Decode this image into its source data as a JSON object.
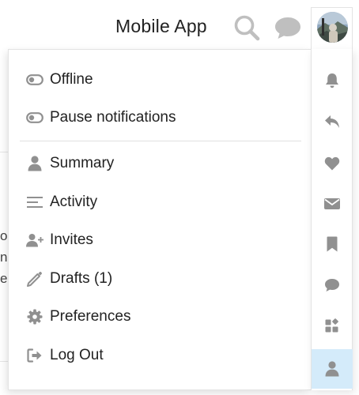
{
  "header": {
    "title": "Mobile App",
    "icons": {
      "search": "search-icon",
      "chat": "chat-bubble-icon",
      "avatar": "user-avatar"
    }
  },
  "background": {
    "fragments": [
      "o",
      "n",
      "e"
    ]
  },
  "menu": {
    "status_items": [
      {
        "label": "Offline",
        "icon": "toggle-icon"
      },
      {
        "label": "Pause notifications",
        "icon": "toggle-icon"
      }
    ],
    "items": [
      {
        "label": "Summary",
        "icon": "user-icon"
      },
      {
        "label": "Activity",
        "icon": "list-icon"
      },
      {
        "label": "Invites",
        "icon": "user-plus-icon"
      },
      {
        "label": "Drafts (1)",
        "icon": "pencil-icon"
      },
      {
        "label": "Preferences",
        "icon": "gear-icon"
      },
      {
        "label": "Log Out",
        "icon": "sign-out-icon"
      }
    ]
  },
  "rail": {
    "tabs": [
      {
        "icon": "bell-icon"
      },
      {
        "icon": "reply-icon"
      },
      {
        "icon": "heart-icon"
      },
      {
        "icon": "envelope-icon"
      },
      {
        "icon": "bookmark-icon"
      },
      {
        "icon": "chat-icon"
      },
      {
        "icon": "widgets-icon"
      },
      {
        "icon": "user-icon",
        "active": true
      }
    ]
  },
  "colors": {
    "text": "#222222",
    "icon_gray": "#909090",
    "header_icon": "#bfbfbf",
    "active_tab_bg": "#d4ebfa",
    "border": "#e3e3e3"
  }
}
